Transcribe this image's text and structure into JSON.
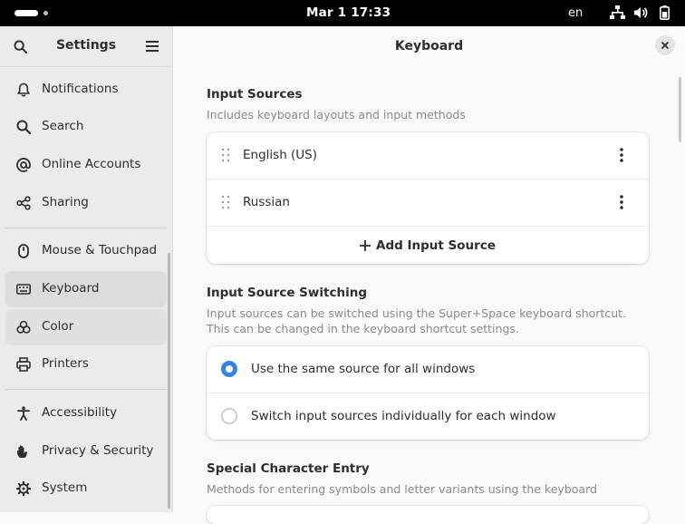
{
  "topbar": {
    "clock": "Mar 1  17:33",
    "input_lang": "en"
  },
  "sidebar": {
    "title": "Settings",
    "items": [
      {
        "label": "Notifications",
        "icon": "bell-icon"
      },
      {
        "label": "Search",
        "icon": "search-icon"
      },
      {
        "label": "Online Accounts",
        "icon": "at-icon"
      },
      {
        "label": "Sharing",
        "icon": "share-icon"
      },
      {
        "label": "Mouse & Touchpad",
        "icon": "mouse-icon"
      },
      {
        "label": "Keyboard",
        "icon": "keyboard-icon",
        "selected": true
      },
      {
        "label": "Color",
        "icon": "color-icon"
      },
      {
        "label": "Printers",
        "icon": "printer-icon"
      },
      {
        "label": "Accessibility",
        "icon": "accessibility-icon"
      },
      {
        "label": "Privacy & Security",
        "icon": "hand-icon"
      },
      {
        "label": "System",
        "icon": "gear-icon"
      }
    ]
  },
  "main": {
    "title": "Keyboard",
    "input_sources": {
      "title": "Input Sources",
      "description": "Includes keyboard layouts and input methods",
      "sources": [
        "English (US)",
        "Russian"
      ],
      "add_label": "Add Input Source"
    },
    "switching": {
      "title": "Input Source Switching",
      "description_line1": "Input sources can be switched using the Super+Space keyboard shortcut.",
      "description_line2": "This can be changed in the keyboard shortcut settings.",
      "options": [
        {
          "label": "Use the same source for all windows",
          "selected": true
        },
        {
          "label": "Switch input sources individually for each window",
          "selected": false
        }
      ]
    },
    "special_chars": {
      "title": "Special Character Entry",
      "description": "Methods for entering symbols and letter variants using the keyboard"
    }
  },
  "colors": {
    "accent": "#3584e4",
    "sidebar_bg": "#ebebeb",
    "topbar_bg": "#000000"
  }
}
